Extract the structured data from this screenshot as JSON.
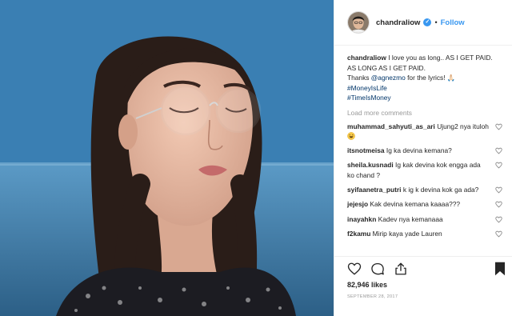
{
  "post": {
    "username": "chandraliow",
    "verified_mark": "✓",
    "separator": "•",
    "follow_label": "Follow"
  },
  "caption": {
    "username": "chandraliow",
    "text1": "I love you as long.. AS I GET PAID.",
    "text2": "AS LONG AS I GET PAID.",
    "thanks_before": "Thanks ",
    "mention": "@agnezmo",
    "thanks_after": " for the lyrics! 🙏🏻",
    "hashtag1": "#MoneyIsLife",
    "hashtag2": "#TimeIsMoney"
  },
  "load_more_label": "Load more comments",
  "comments": [
    {
      "username": "muhammad_sahyuti_as_ari",
      "text": "Ujung2 nya ituloh",
      "emoji": "laughing-emoji"
    },
    {
      "username": "itsnotmeisa",
      "text": "Ig ka devina kemana?"
    },
    {
      "username": "sheila.kusnadi",
      "text": "Ig kak devina kok engga ada ko chand ?"
    },
    {
      "username": "syifaanetra_putri",
      "text": "k ig k devina kok ga ada?"
    },
    {
      "username": "jejesjo",
      "text": "Kak devina kemana kaaaa???"
    },
    {
      "username": "inayahkn",
      "text": "Kadev nya kemanaaa"
    },
    {
      "username": "f2kamu",
      "text": "Mirip kaya yade Lauren"
    }
  ],
  "likes": "82,946 likes",
  "date": "SEPTEMBER 28, 2017",
  "icons": [
    "heart-icon",
    "comment-icon",
    "share-icon",
    "bookmark-icon",
    "verified-badge-icon"
  ],
  "colors": {
    "link": "#003569",
    "follow": "#3897f0",
    "muted": "#999999",
    "text": "#262626"
  }
}
